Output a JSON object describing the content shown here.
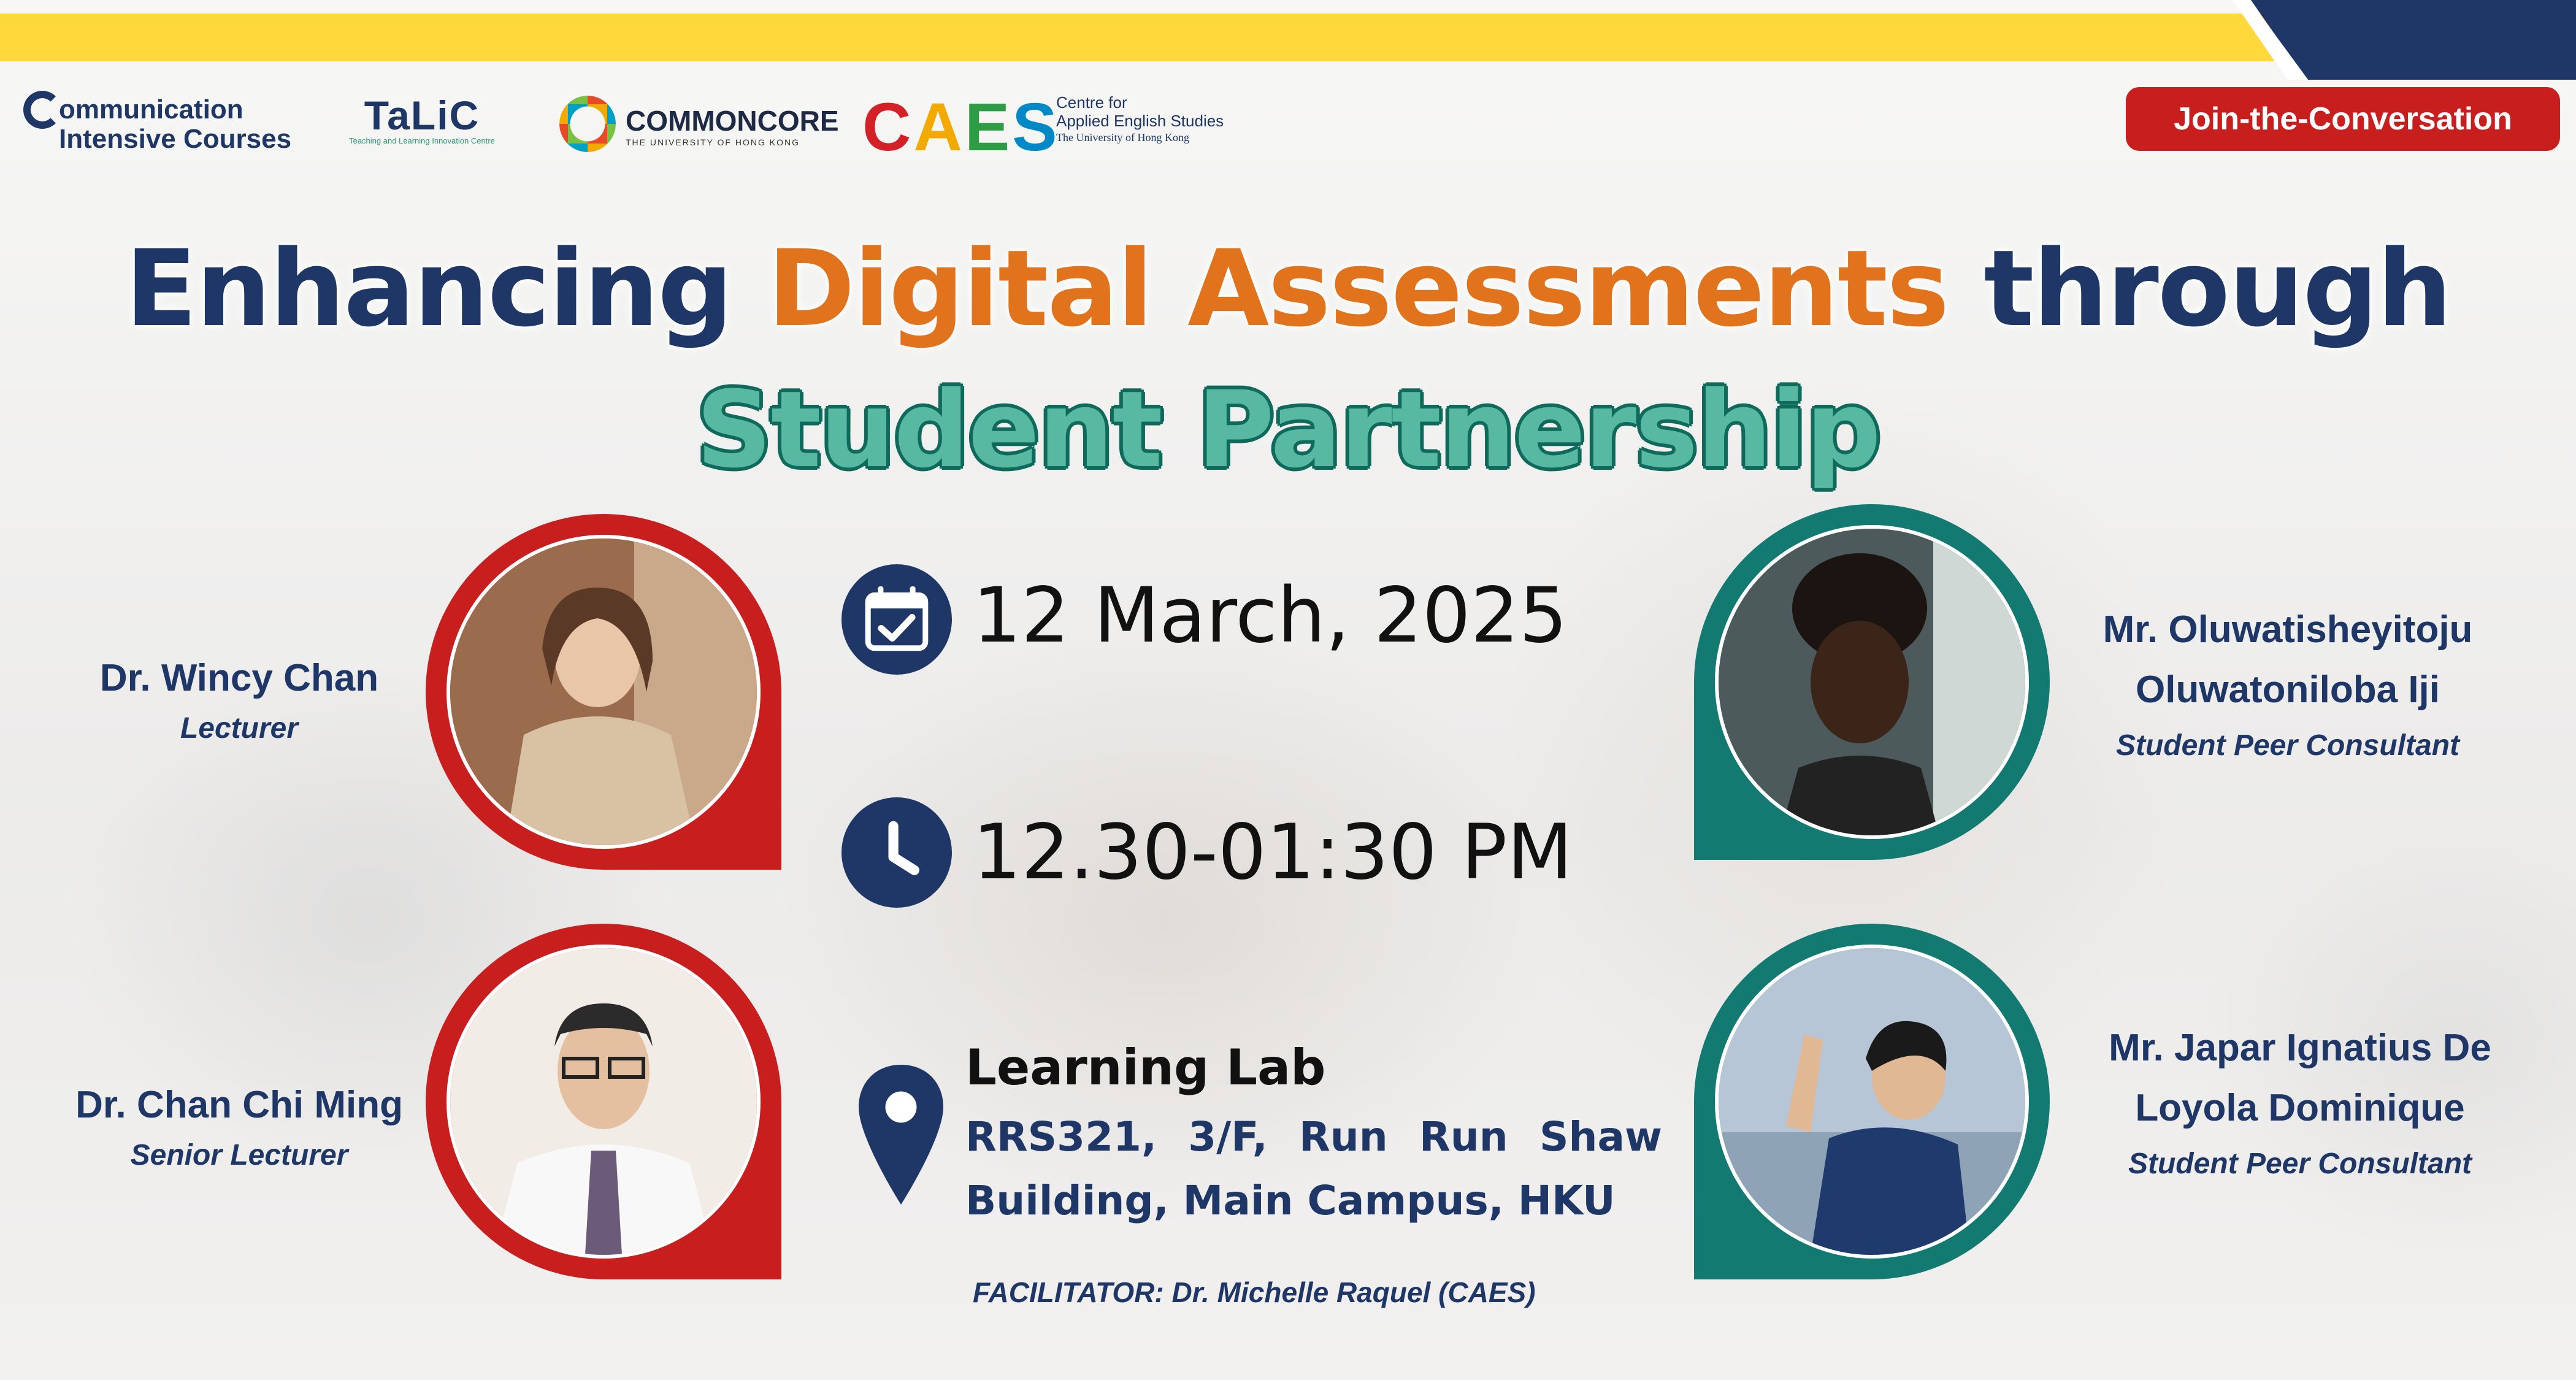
{
  "header": {
    "logos": {
      "cic_line1": "ommunication",
      "cic_line2": "ntensive Courses",
      "talic": "TaLiC",
      "talic_sub": "Teaching and Learning Innovation Centre",
      "commoncore": "COMMONCORE",
      "commoncore_sub": "THE UNIVERSITY OF HONG KONG",
      "caes": "CAES",
      "caes_line1": "Centre for",
      "caes_line2": "Applied English Studies",
      "caes_line3": "The University of Hong Kong"
    },
    "join_button": "Join-the-Conversation",
    "accent_colors": {
      "navy": "#1e3766",
      "yellow": "#ffd83b",
      "red": "#c81e1e",
      "teal": "#137a72",
      "orange": "#e2731d",
      "mint": "#58b9a3"
    }
  },
  "title": {
    "part1": "Enhancing ",
    "accent": "Digital Assessments",
    "part3": " through",
    "line2": "Student Partnership"
  },
  "speakers": [
    {
      "name": "Dr. Wincy Chan",
      "role": "Lecturer",
      "photo": "portrait-photo"
    },
    {
      "name": "Dr. Chan Chi Ming",
      "role": "Senior Lecturer",
      "photo": "portrait-photo"
    },
    {
      "name_line1": "Mr. Oluwatisheyitoju",
      "name_line2": "Oluwatoniloba Iji",
      "role": "Student Peer Consultant",
      "photo": "portrait-photo"
    },
    {
      "name_line1": "Mr. Japar Ignatius De",
      "name_line2": "Loyola Dominique",
      "role": "Student Peer Consultant",
      "photo": "portrait-photo"
    }
  ],
  "event": {
    "date": "12 March, 2025",
    "time": "12.30-01:30 PM",
    "venue_title": "Learning Lab",
    "venue_address": "RRS321, 3/F, Run Run Shaw Building, Main Campus, HKU",
    "facilitator": "FACILITATOR: Dr. Michelle Raquel (CAES)",
    "icons": [
      "calendar-icon",
      "clock-icon",
      "location-pin-icon"
    ]
  }
}
